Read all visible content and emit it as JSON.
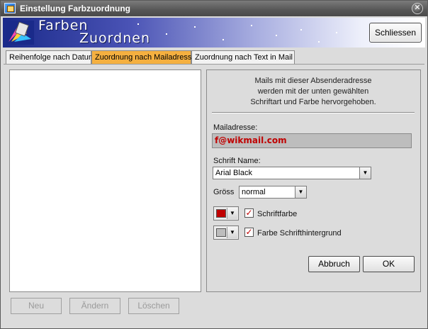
{
  "window": {
    "title": "Einstellung Farbzuordnung"
  },
  "banner": {
    "line1": "Farben",
    "line2": "Zuordnen"
  },
  "header": {
    "close_label": "Schliessen"
  },
  "tabs": [
    {
      "label": "Reihenfolge nach Datum",
      "active": false
    },
    {
      "label": "Zuordnung nach Mailadresse",
      "active": true
    },
    {
      "label": "Zuordnung nach Text in Mail",
      "active": false
    }
  ],
  "left": {
    "buttons": {
      "new": "Neu",
      "edit": "Ändern",
      "delete": "Löschen"
    }
  },
  "right": {
    "info": [
      "Mails mit dieser Absenderadresse",
      "werden mit der unten gewählten",
      "Schriftart und Farbe hervorgehoben."
    ],
    "mail_label": "Mailadresse:",
    "mail_value": "f@wikmail.com",
    "font_label": "Schrift Name:",
    "font_value": "Arial Black",
    "size_label": "Gröss",
    "size_value": "normal",
    "fontcolor_label": "Schriftfarbe",
    "fontcolor_swatch": "#c00000",
    "fontcolor_checked": true,
    "bgcolor_label": "Farbe Schrifthintergrund",
    "bgcolor_swatch": "#bdbdbd",
    "bgcolor_checked": true,
    "cancel_label": "Abbruch",
    "ok_label": "OK"
  },
  "colors": {
    "accent_tab": "#f5b040",
    "mail_text": "#c00000"
  }
}
